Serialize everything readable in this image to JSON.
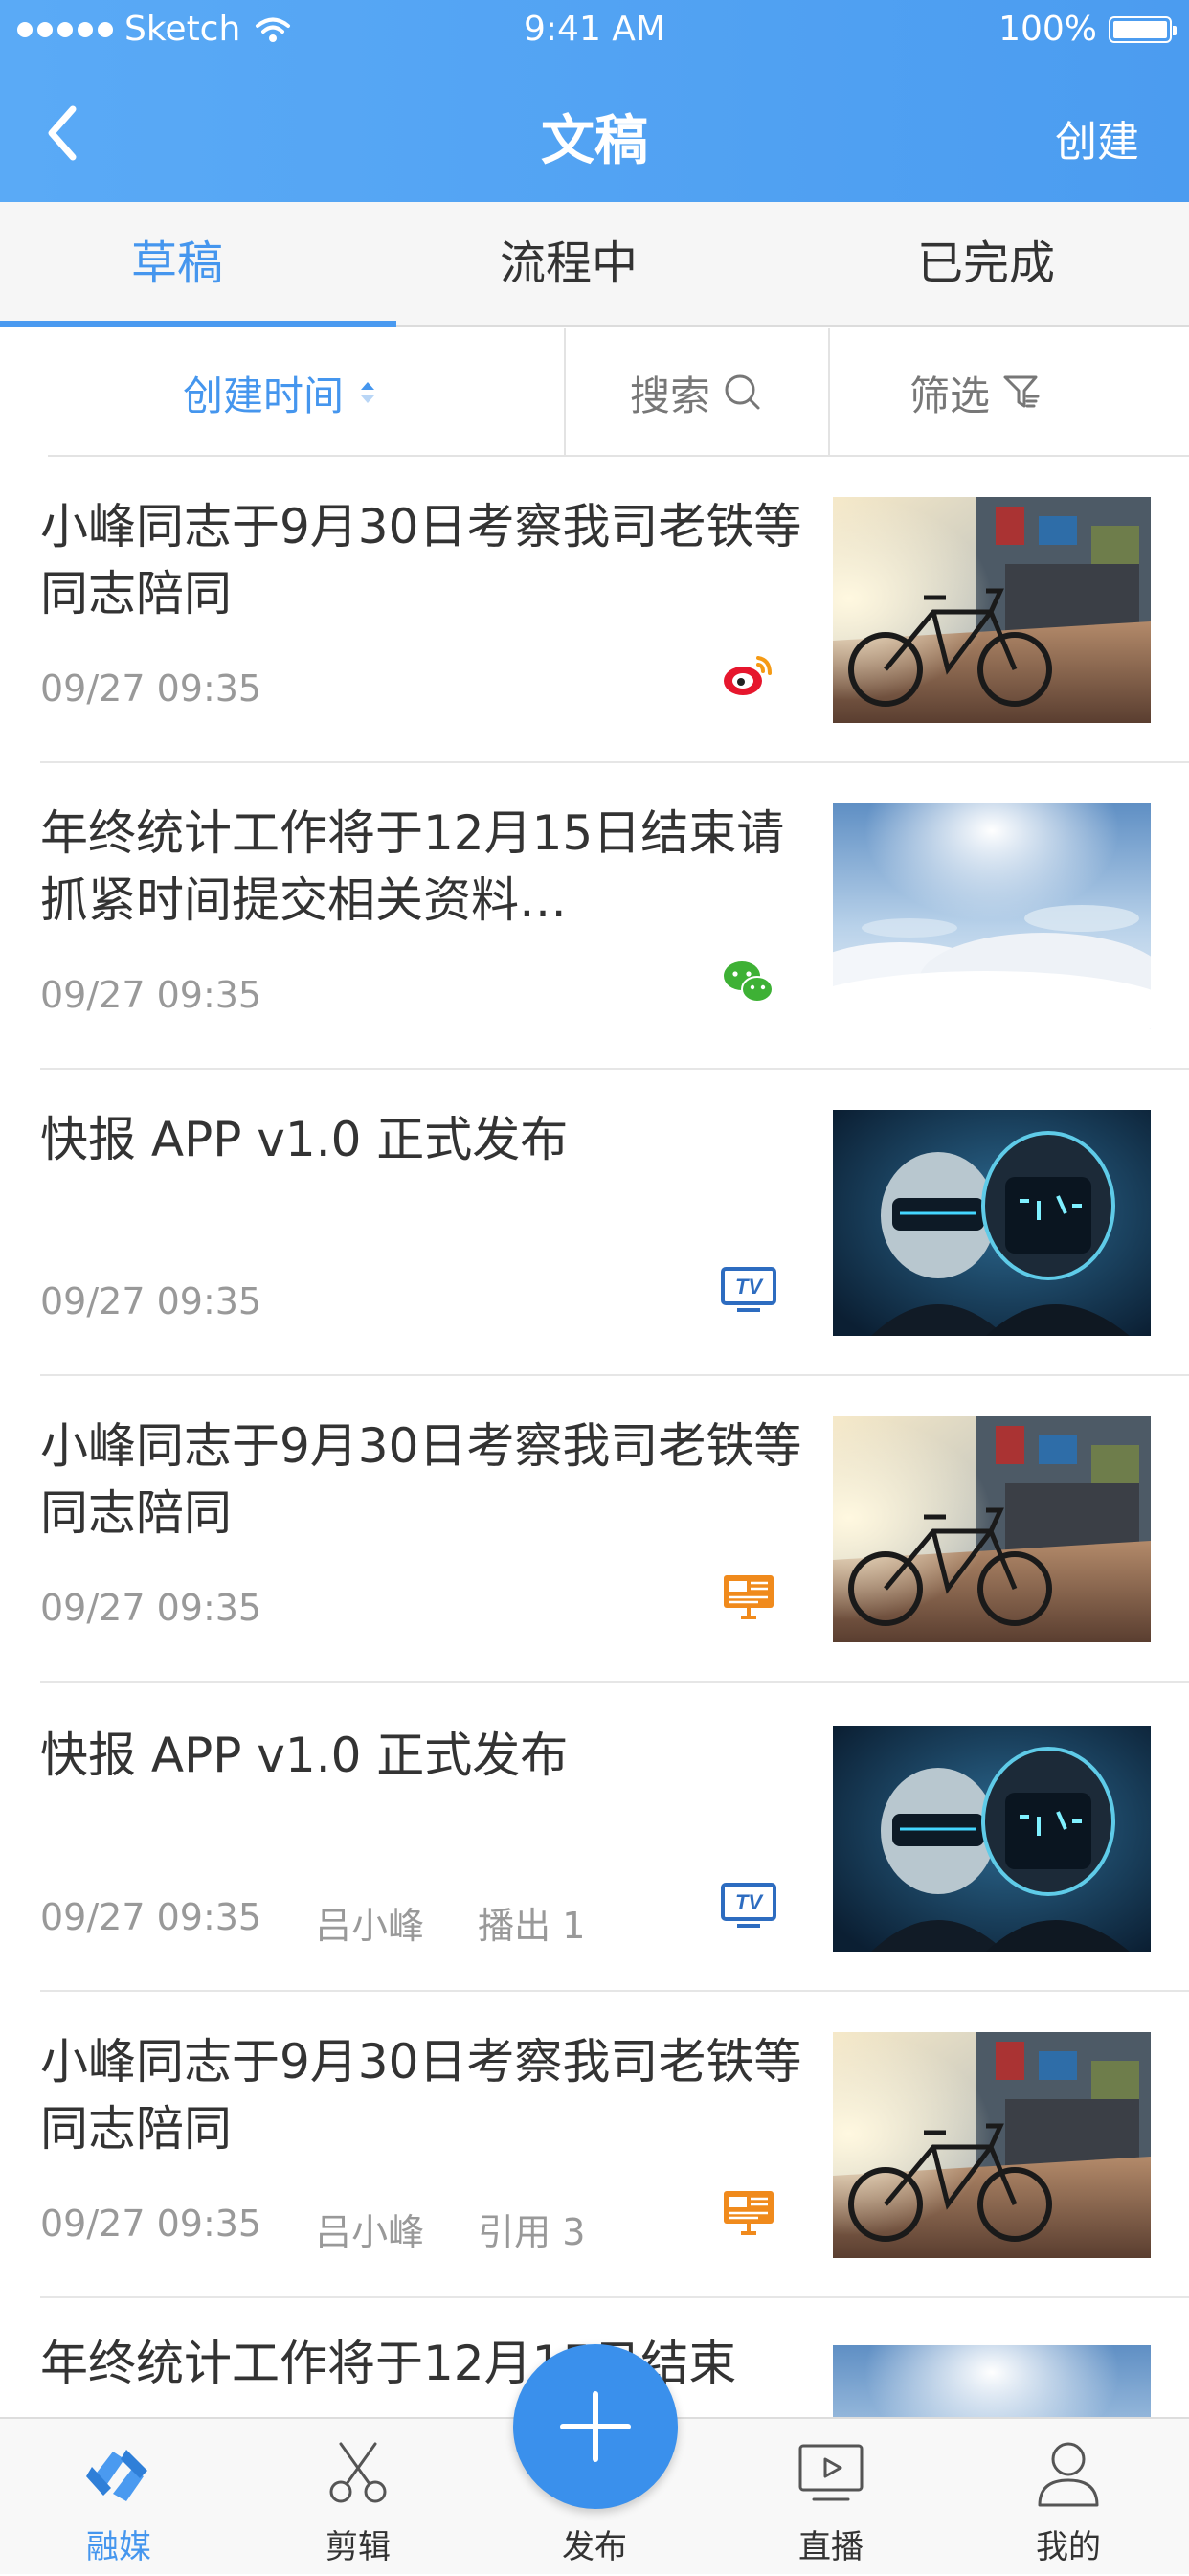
{
  "status_bar": {
    "carrier": "Sketch",
    "time": "9:41 AM",
    "battery": "100%"
  },
  "nav": {
    "title": "文稿",
    "action": "创建"
  },
  "tabs": [
    {
      "label": "草稿",
      "active": true
    },
    {
      "label": "流程中",
      "active": false
    },
    {
      "label": "已完成",
      "active": false
    }
  ],
  "filters": {
    "sort_label": "创建时间",
    "search_label": "搜索",
    "filter_label": "筛选"
  },
  "items": [
    {
      "title": "小峰同志于9月30日考察我司老铁等同志陪同",
      "time": "09/27 09:35",
      "author": "",
      "stat": "",
      "channel": "weibo-icon",
      "thumb": "street-bicycle-photo"
    },
    {
      "title": "年终统计工作将于12月15日结束请抓紧时间提交相关资料…",
      "time": "09/27 09:35",
      "author": "",
      "stat": "",
      "channel": "wechat-icon",
      "thumb": "sky-clouds-photo"
    },
    {
      "title": "快报 APP v1.0 正式发布",
      "time": "09/27 09:35",
      "author": "",
      "stat": "",
      "channel": "tv-icon",
      "thumb": "robot-helmets-photo"
    },
    {
      "title": "小峰同志于9月30日考察我司老铁等同志陪同",
      "time": "09/27 09:35",
      "author": "",
      "stat": "",
      "channel": "web-screen-icon",
      "thumb": "street-bicycle-photo"
    },
    {
      "title": "快报 APP v1.0 正式发布",
      "time": "09/27 09:35",
      "author": "吕小峰",
      "stat": "播出 1",
      "channel": "tv-icon",
      "thumb": "robot-helmets-photo"
    },
    {
      "title": "小峰同志于9月30日考察我司老铁等同志陪同",
      "time": "09/27 09:35",
      "author": "吕小峰",
      "stat": "引用 3",
      "channel": "web-screen-icon",
      "thumb": "street-bicycle-photo"
    },
    {
      "title": "年终统计工作将于12月15日结束",
      "time": "",
      "author": "",
      "stat": "",
      "channel": "",
      "thumb": "sky-clouds-photo"
    }
  ],
  "tabbar": [
    {
      "label": "融媒",
      "icon": "media-fusion-icon",
      "active": true
    },
    {
      "label": "剪辑",
      "icon": "scissors-icon",
      "active": false
    },
    {
      "label": "发布",
      "icon": "plus-icon",
      "active": false
    },
    {
      "label": "直播",
      "icon": "live-screen-icon",
      "active": false
    },
    {
      "label": "我的",
      "icon": "profile-icon",
      "active": false
    }
  ],
  "colors": {
    "accent": "#4596EE",
    "header": "#53A3F4",
    "weibo": "#E6162D",
    "wechat": "#3EB135",
    "tv": "#2D6CC0",
    "web": "#F08A1C"
  }
}
